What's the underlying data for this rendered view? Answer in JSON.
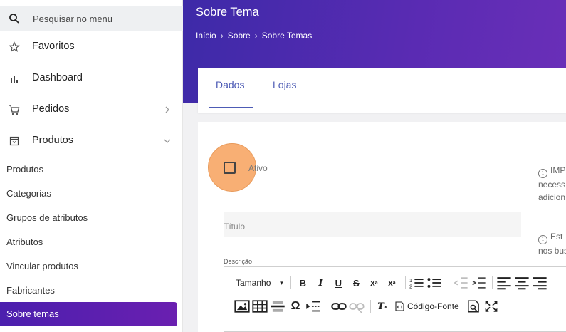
{
  "sidebar": {
    "search_label": "Pesquisar no menu",
    "items": [
      {
        "label": "Favoritos",
        "icon": "star-icon"
      },
      {
        "label": "Dashboard",
        "icon": "bar-chart-icon"
      },
      {
        "label": "Pedidos",
        "icon": "cart-icon"
      },
      {
        "label": "Produtos",
        "icon": "box-icon"
      }
    ],
    "sub_items": [
      "Produtos",
      "Categorias",
      "Grupos de atributos",
      "Atributos",
      "Vincular produtos",
      "Fabricantes",
      "Sobre temas"
    ]
  },
  "header": {
    "title": "Sobre Tema",
    "breadcrumbs": [
      "Início",
      "Sobre",
      "Sobre Temas"
    ],
    "separator": "›"
  },
  "tabs": [
    "Dados",
    "Lojas"
  ],
  "form": {
    "ativo_label": "Ativo",
    "info1_line1": "IMP",
    "info1_line2": "necess",
    "info1_line3": "adicion",
    "titulo_placeholder": "Título",
    "info2_line1": "Est",
    "info2_line2": "nos bus",
    "descricao_label": "Descrição",
    "toolbar": {
      "size_label": "Tamanho",
      "source_label": "Código-Fonte"
    }
  },
  "colors": {
    "accent": "#4d5bb5",
    "header_start": "#3d2aa8",
    "header_end": "#6a2fb8",
    "active_item": "#5a1fb0",
    "highlight": "#f59446"
  }
}
